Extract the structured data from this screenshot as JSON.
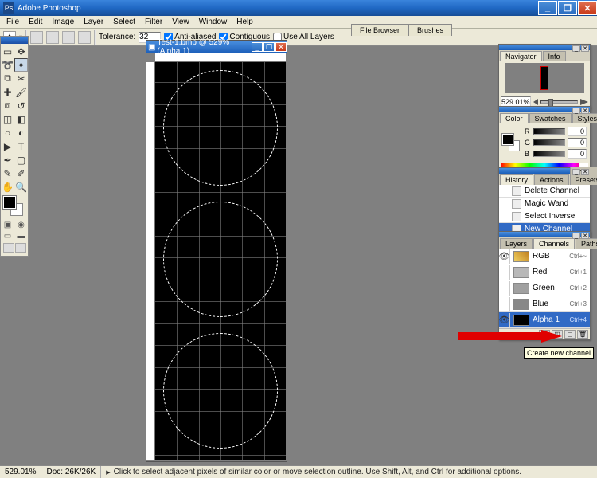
{
  "app": {
    "title": "Adobe Photoshop"
  },
  "menu": [
    "File",
    "Edit",
    "Image",
    "Layer",
    "Select",
    "Filter",
    "View",
    "Window",
    "Help"
  ],
  "options": {
    "tolerance_label": "Tolerance:",
    "tolerance_value": "32",
    "antialiased": "Anti-aliased",
    "contiguous": "Contiguous",
    "use_all_layers": "Use All Layers"
  },
  "palette_well": [
    "File Browser",
    "Brushes"
  ],
  "document": {
    "title": "Test-1.bmp @ 529% (Alpha 1)"
  },
  "navigator": {
    "tabs": [
      "Navigator",
      "Info"
    ],
    "zoom": "529.01%"
  },
  "color": {
    "tabs": [
      "Color",
      "Swatches",
      "Styles"
    ],
    "r": "0",
    "g": "0",
    "b": "0"
  },
  "history": {
    "tabs": [
      "History",
      "Actions",
      "Tool Presets"
    ],
    "items": [
      "Delete Channel",
      "Magic Wand",
      "Select Inverse",
      "New Channel"
    ]
  },
  "channels": {
    "tabs": [
      "Layers",
      "Channels",
      "Paths"
    ],
    "rows": [
      {
        "name": "RGB",
        "short": "Ctrl+~",
        "eye": true,
        "thumb": "linear-gradient(45deg,#f0d060,#c08020)"
      },
      {
        "name": "Red",
        "short": "Ctrl+1",
        "eye": false,
        "thumb": "#b8b8b8"
      },
      {
        "name": "Green",
        "short": "Ctrl+2",
        "eye": false,
        "thumb": "#a0a0a0"
      },
      {
        "name": "Blue",
        "short": "Ctrl+3",
        "eye": false,
        "thumb": "#888888"
      },
      {
        "name": "Alpha 1",
        "short": "Ctrl+4",
        "eye": true,
        "thumb": "#000",
        "active": true
      }
    ]
  },
  "tooltip": "Create new channel",
  "status": {
    "zoom": "529.01%",
    "doc": "Doc: 26K/26K",
    "hint": "Click to select adjacent pixels of similar color or move selection outline. Use Shift, Alt, and Ctrl for additional options."
  }
}
